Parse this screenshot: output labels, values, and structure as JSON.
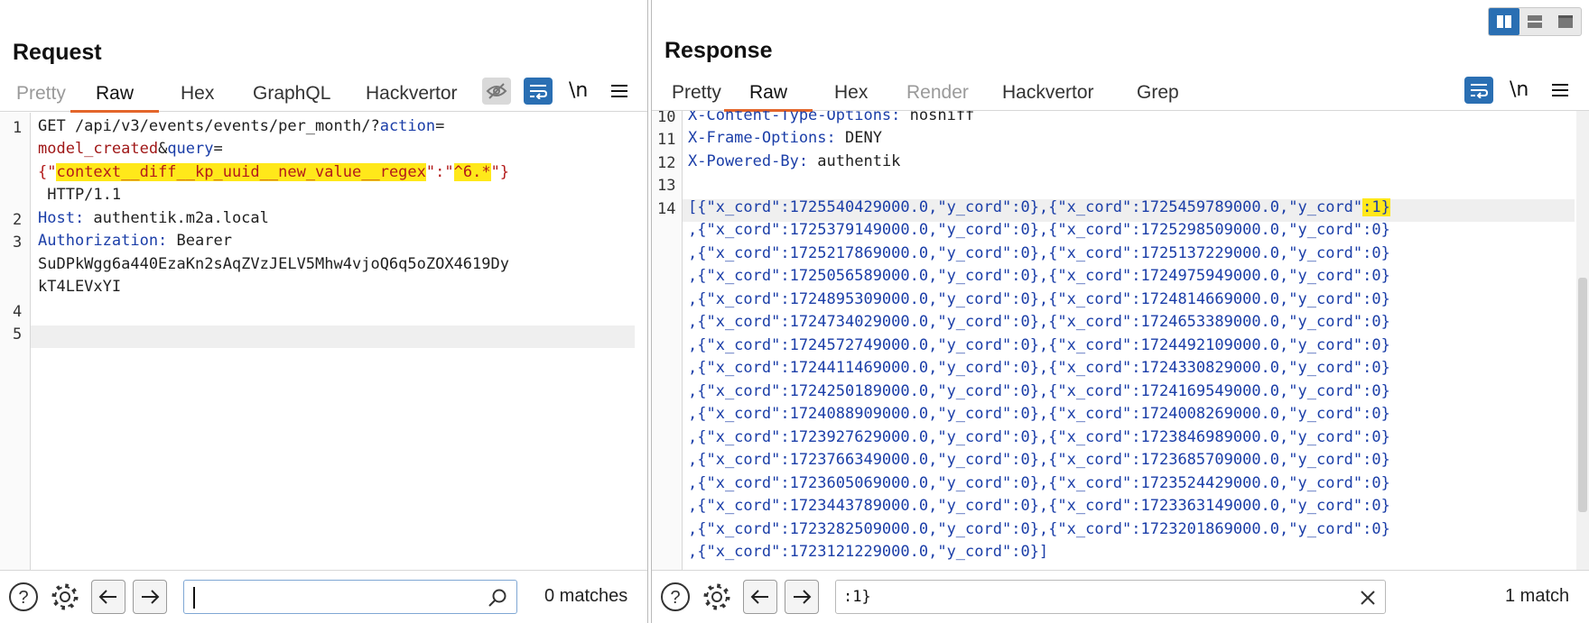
{
  "request": {
    "title": "Request",
    "tabs": [
      "Pretty",
      "Raw",
      "Hex",
      "GraphQL",
      "Hackvertor"
    ],
    "active_tab": "Raw",
    "wrap_label": "\\n",
    "lines": {
      "l1_method": "GET /api/v3/events/events/per_month/?",
      "l1_param1_name": "action",
      "l1_eq": "=",
      "l1_param1_value": "model_created",
      "l1_amp": "&",
      "l1_param2_name": "query",
      "l1_eq2": "=",
      "l1_brace_open": "{\"",
      "l1_key": "context__diff__kp_uuid__new_value__regex",
      "l1_sep": "\":\"",
      "l1_val": "^6.*",
      "l1_brace_close": "\"}",
      "l1_proto": " HTTP/1.1",
      "l2_name": "Host:",
      "l2_value": " authentik.m2a.local",
      "l3_name": "Authorization:",
      "l3_value": " Bearer",
      "l3_token1": "SuDPkWgg6a440EzaKn2sAqZVzJELV5Mhw4vjoQ6q5oZOX4619Dy",
      "l3_token2": "kT4LEVxYI"
    },
    "line_numbers": [
      "1",
      "2",
      "3",
      "4",
      "5"
    ],
    "search": {
      "value": "",
      "matches": "0 matches"
    }
  },
  "response": {
    "title": "Response",
    "tabs": [
      "Pretty",
      "Raw",
      "Hex",
      "Render",
      "Hackvertor",
      "Grep"
    ],
    "active_tab": "Raw",
    "wrap_label": "\\n",
    "line_numbers": [
      "10",
      "11",
      "12",
      "13",
      "14"
    ],
    "headers": [
      {
        "name": "X-Content-Type-Options:",
        "value": " nosniff"
      },
      {
        "name": "X-Frame-Options:",
        "value": " DENY"
      },
      {
        "name": "X-Powered-By:",
        "value": " authentik"
      }
    ],
    "body_rows": [
      "[{\"x_cord\":1725540429000.0,\"y_cord\":0},{\"x_cord\":1725459789000.0,\"y_cord\"",
      ",{\"x_cord\":1725379149000.0,\"y_cord\":0},{\"x_cord\":1725298509000.0,\"y_cord\":0}",
      ",{\"x_cord\":1725217869000.0,\"y_cord\":0},{\"x_cord\":1725137229000.0,\"y_cord\":0}",
      ",{\"x_cord\":1725056589000.0,\"y_cord\":0},{\"x_cord\":1724975949000.0,\"y_cord\":0}",
      ",{\"x_cord\":1724895309000.0,\"y_cord\":0},{\"x_cord\":1724814669000.0,\"y_cord\":0}",
      ",{\"x_cord\":1724734029000.0,\"y_cord\":0},{\"x_cord\":1724653389000.0,\"y_cord\":0}",
      ",{\"x_cord\":1724572749000.0,\"y_cord\":0},{\"x_cord\":1724492109000.0,\"y_cord\":0}",
      ",{\"x_cord\":1724411469000.0,\"y_cord\":0},{\"x_cord\":1724330829000.0,\"y_cord\":0}",
      ",{\"x_cord\":1724250189000.0,\"y_cord\":0},{\"x_cord\":1724169549000.0,\"y_cord\":0}",
      ",{\"x_cord\":1724088909000.0,\"y_cord\":0},{\"x_cord\":1724008269000.0,\"y_cord\":0}",
      ",{\"x_cord\":1723927629000.0,\"y_cord\":0},{\"x_cord\":1723846989000.0,\"y_cord\":0}",
      ",{\"x_cord\":1723766349000.0,\"y_cord\":0},{\"x_cord\":1723685709000.0,\"y_cord\":0}",
      ",{\"x_cord\":1723605069000.0,\"y_cord\":0},{\"x_cord\":1723524429000.0,\"y_cord\":0}",
      ",{\"x_cord\":1723443789000.0,\"y_cord\":0},{\"x_cord\":1723363149000.0,\"y_cord\":0}",
      ",{\"x_cord\":1723282509000.0,\"y_cord\":0},{\"x_cord\":1723201869000.0,\"y_cord\":0}",
      ",{\"x_cord\":1723121229000.0,\"y_cord\":0}]"
    ],
    "first_row_match": ":1}",
    "search": {
      "value": ":1}",
      "matches": "1 match"
    }
  },
  "colors": {
    "accent": "#e3662b",
    "button_blue": "#2a6fb3",
    "highlight": "#ffe81a",
    "key_blue": "#1b3ea8",
    "value_red": "#a01818"
  },
  "icons": [
    "help-icon",
    "gear-icon",
    "back-arrow-icon",
    "forward-arrow-icon",
    "search-icon",
    "clear-icon",
    "wrap-icon",
    "menu-icon",
    "eye-off-icon",
    "layout-icons"
  ]
}
